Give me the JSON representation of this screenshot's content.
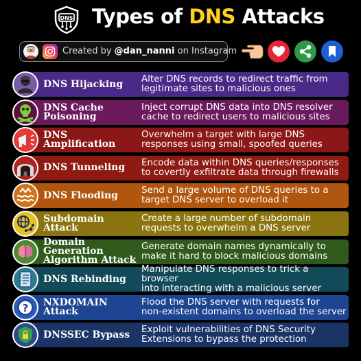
{
  "header": {
    "title_prefix": "Types of",
    "title_accent": "DNS",
    "title_suffix": "Attacks",
    "logo_text": "DNS",
    "accent_color": "#ffd21f"
  },
  "credit": {
    "prefix": "Created by",
    "handle": "@dan_nanni",
    "suffix": "on Instagram"
  },
  "actions": {
    "icons": [
      "pointing-hand-icon",
      "heart-icon",
      "share-icon",
      "bookmark-icon"
    ]
  },
  "attacks": [
    {
      "name_l1": "DNS Hijacking",
      "name_l2": "",
      "desc_l1": "Alter DNS records to redirect traffic from",
      "desc_l2": "legitimate sites to malicious ones",
      "color": "#4a2a88",
      "icon": "hacker-icon"
    },
    {
      "name_l1": "DNS Cache",
      "name_l2": "Poisoning",
      "desc_l1": "Inject corrupt DNS data into DNS resolver",
      "desc_l2": "cache to redirect users to malicious sites",
      "color": "#6b1a5e",
      "icon": "poison-skull-icon"
    },
    {
      "name_l1": "DNS Amplification",
      "name_l2": "",
      "desc_l1": "Overwhelm a target with large DNS",
      "desc_l2": "responses using small, spoofed queries",
      "color": "#8b1717",
      "icon": "megaphone-icon"
    },
    {
      "name_l1": "DNS Tunneling",
      "name_l2": "",
      "desc_l1": "Encode data within DNS queries/responses",
      "desc_l2": "to covertly exfiltrate data through firewalls",
      "color": "#8f1a12",
      "icon": "tunnel-icon"
    },
    {
      "name_l1": "DNS Flooding",
      "name_l2": "",
      "desc_l1": "Send a large volume of DNS queries to a",
      "desc_l2": "target DNS server to overload it",
      "color": "#b0560f",
      "icon": "flood-icon"
    },
    {
      "name_l1": "Subdomain Attack",
      "name_l2": "",
      "desc_l1": "Create a large number of subdomain",
      "desc_l2": "requests to overwhelm a DNS server",
      "color": "#8a7410",
      "icon": "globe-network-icon"
    },
    {
      "name_l1": "Domain Generation",
      "name_l2": "Algorithm Attack",
      "desc_l1": "Generate domain names dynamically to",
      "desc_l2": "make it hard to block malicious domains",
      "color": "#2f5a1c",
      "icon": "brain-circuit-icon"
    },
    {
      "name_l1": "DNS Rebinding",
      "name_l2": "",
      "desc_l1": "Manipulate DNS responses to trick a browser",
      "desc_l2": "into interacting with a malicious server",
      "color": "#134a5a",
      "icon": "notebook-icon"
    },
    {
      "name_l1": "NXDOMAIN Attack",
      "name_l2": "",
      "desc_l1": "Flood the DNS server with requests for",
      "desc_l2": "non-existent domains to overload the server",
      "color": "#1d4592",
      "icon": "question-icon"
    },
    {
      "name_l1": "DNSSEC Bypass",
      "name_l2": "",
      "desc_l1": "Exploit vulnerabilities of DNS Security",
      "desc_l2": "Extensions to bypass the protection",
      "color": "#1a3466",
      "icon": "shield-icon"
    }
  ]
}
